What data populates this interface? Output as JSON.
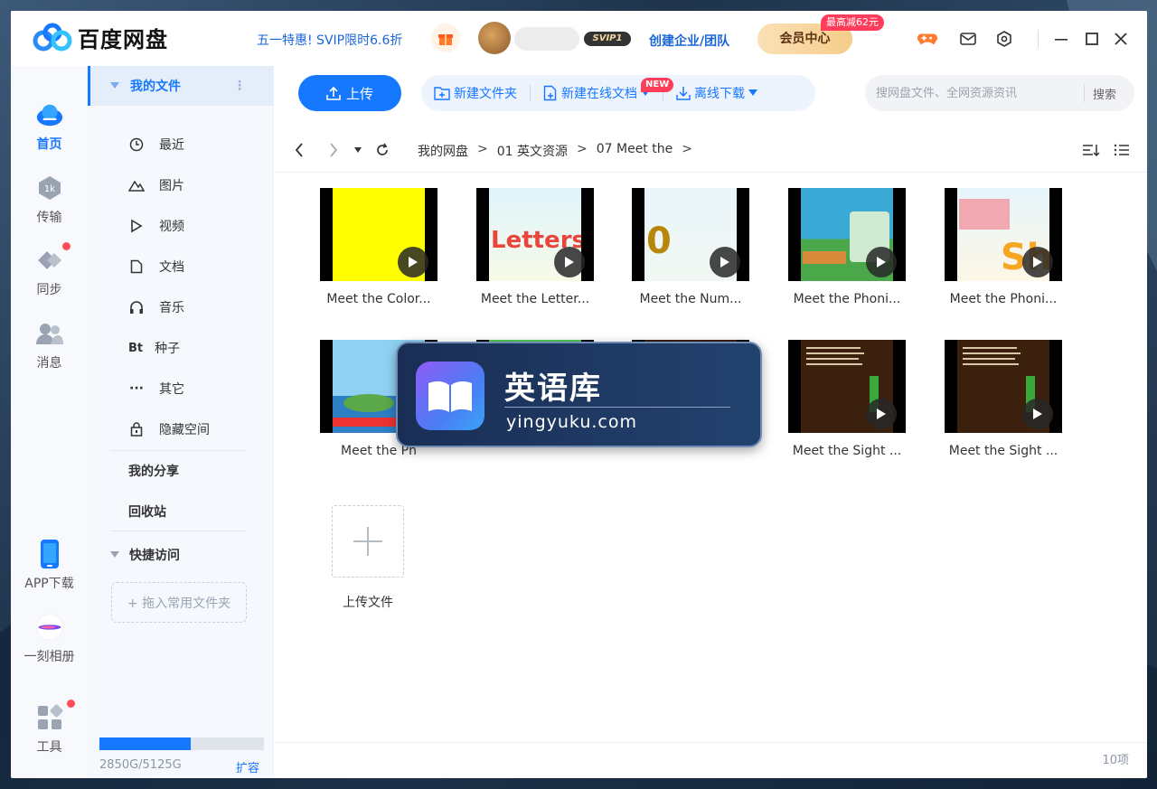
{
  "app": {
    "title": "百度网盘"
  },
  "header": {
    "promo": "五一特惠! SVIP限时6.6折",
    "svip_badge": "SVIP1",
    "team_link": "创建企业/团队",
    "vip_button": "会员中心",
    "vip_badge": "最高减62元"
  },
  "rail": {
    "items": [
      {
        "label": "首页",
        "icon": "cloud-icon"
      },
      {
        "label": "传输",
        "icon": "transfer-icon"
      },
      {
        "label": "同步",
        "icon": "sync-icon"
      },
      {
        "label": "消息",
        "icon": "message-icon"
      },
      {
        "label": "APP下载",
        "icon": "phone-icon"
      },
      {
        "label": "一刻相册",
        "icon": "album-icon"
      },
      {
        "label": "工具",
        "icon": "tools-icon"
      }
    ]
  },
  "sidebar": {
    "my_files": "我的文件",
    "items": [
      {
        "label": "最近",
        "icon": "clock-icon"
      },
      {
        "label": "图片",
        "icon": "image-icon"
      },
      {
        "label": "视频",
        "icon": "video-icon"
      },
      {
        "label": "文档",
        "icon": "document-icon"
      },
      {
        "label": "音乐",
        "icon": "headphones-icon"
      },
      {
        "label": "种子",
        "icon": "bt-icon",
        "glyph": "Bt"
      },
      {
        "label": "其它",
        "icon": "more-icon",
        "glyph": "···"
      },
      {
        "label": "隐藏空间",
        "icon": "lock-icon"
      }
    ],
    "my_share": "我的分享",
    "recycle": "回收站",
    "quick_access": "快捷访问",
    "drop_hint": "+ 拖入常用文件夹",
    "storage": {
      "used_text": "2850G/5125G",
      "used_fraction": 0.556,
      "expand": "扩容"
    }
  },
  "toolbar": {
    "upload": "上传",
    "new_folder": "新建文件夹",
    "new_doc": "新建在线文档",
    "new_badge": "NEW",
    "offline": "离线下载",
    "search_placeholder": "搜网盘文件、全网资源资讯",
    "search_button": "搜索"
  },
  "breadcrumb": [
    "我的网盘",
    "01 英文资源",
    "07 Meet the"
  ],
  "files": [
    {
      "name": "Meet the Color...",
      "thumb": "yellow"
    },
    {
      "name": "Meet the Letter...",
      "thumb": "letters"
    },
    {
      "name": "Meet the Num...",
      "thumb": "numbers"
    },
    {
      "name": "Meet the Phoni...",
      "thumb": "phonics1"
    },
    {
      "name": "Meet the Phoni...",
      "thumb": "phonics2"
    },
    {
      "name": "Meet the Ph",
      "thumb": "island"
    },
    {
      "name": "",
      "thumb": "green"
    },
    {
      "name": "",
      "thumb": "brown"
    },
    {
      "name": "Meet the Sight ...",
      "thumb": "sight"
    },
    {
      "name": "Meet the Sight ...",
      "thumb": "sight"
    }
  ],
  "upload_tile": "上传文件",
  "item_count": "10项",
  "watermark": {
    "title": "英语库",
    "subtitle": "yingyuku.com"
  }
}
